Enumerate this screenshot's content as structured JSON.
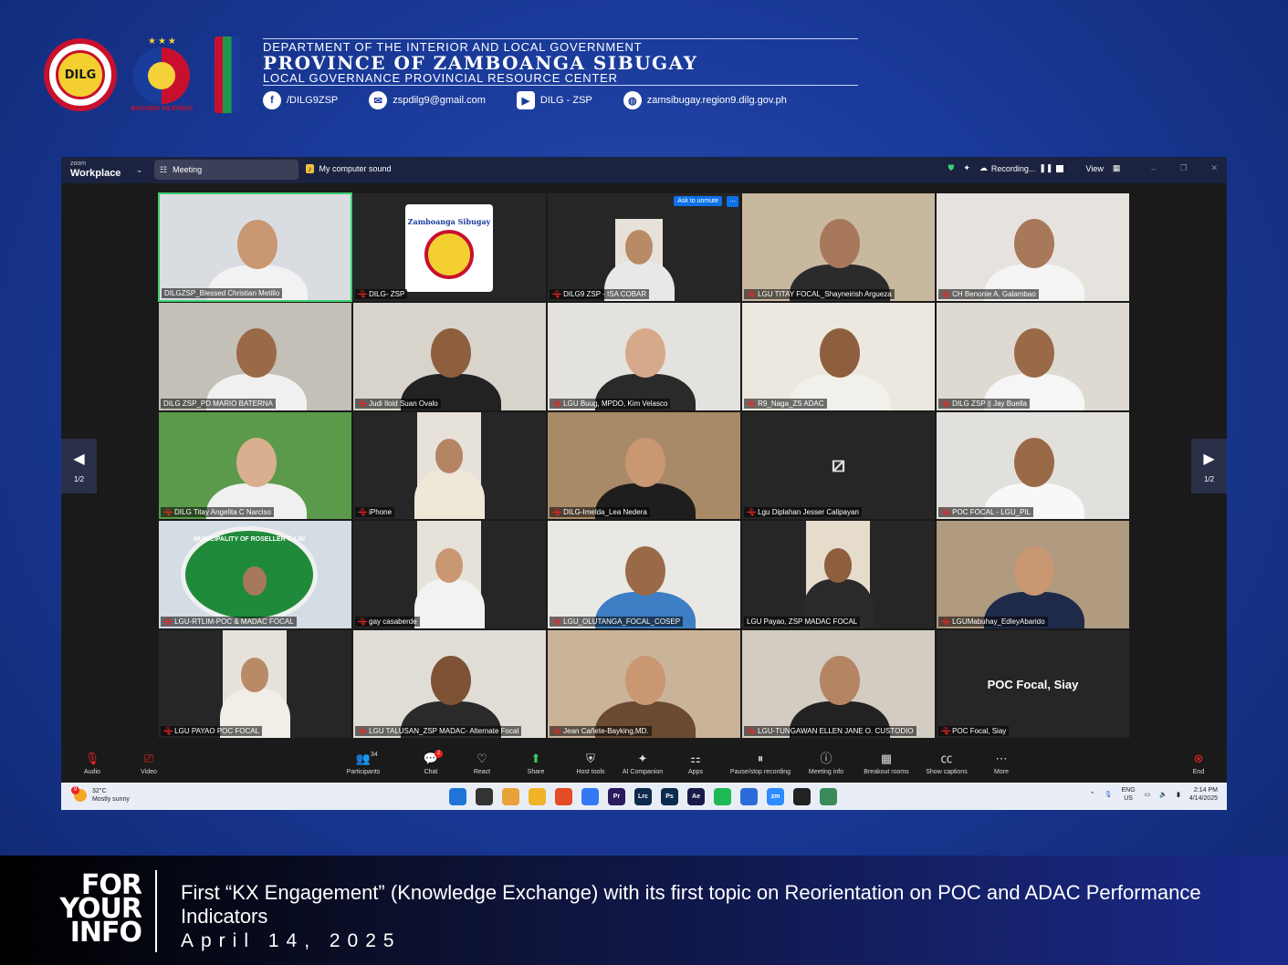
{
  "header": {
    "seal_text": "DILG",
    "bp_text": "BAGONG PILIPINAS",
    "dept": "DEPARTMENT OF THE INTERIOR AND LOCAL GOVERNMENT",
    "province": "PROVINCE OF ZAMBOANGA SIBUGAY",
    "center": "LOCAL GOVERNANCE PROVINCIAL RESOURCE CENTER",
    "contacts": [
      {
        "icon": "facebook-icon",
        "text": "/DILG9ZSP"
      },
      {
        "icon": "email-icon",
        "text": "zspdilg9@gmail.com"
      },
      {
        "icon": "youtube-icon",
        "text": "DILG - ZSP"
      },
      {
        "icon": "globe-icon",
        "text": "zamsibugay.region9.dilg.gov.ph"
      }
    ]
  },
  "zoom": {
    "brand_top": "zoom",
    "brand": "Workplace",
    "meeting_tab": "Meeting",
    "sound": "My computer sound",
    "recording": "Recording...",
    "view": "View",
    "ask_unmute": "Ask to unmute",
    "page_left": "1/2",
    "page_right": "1/2",
    "participants": [
      {
        "name": "DILGZSP_Blessed Christian Metillo",
        "muted": false,
        "bg": "#d9dde2",
        "skin": "#c99772",
        "shirt": "#f2f2f2",
        "active": true
      },
      {
        "name": "DILG- ZSP",
        "muted": true,
        "bg": "#262626",
        "logo": "Zamboanga Sibugay"
      },
      {
        "name": "DILG9 ZSP - ISA COBAR",
        "muted": true,
        "bg": "#262626",
        "small": true,
        "skin": "#b98a66",
        "shirt": "#e8e8e8"
      },
      {
        "name": "LGU TITAY FOCAL_Shayneirish Argueza",
        "muted": true,
        "bg": "#c8b8a0",
        "skin": "#a8785a",
        "shirt": "#2b2b2b"
      },
      {
        "name": "CH Benonie A. Galambao",
        "muted": true,
        "bg": "#e6e3de",
        "skin": "#a8785a",
        "shirt": "#f4f4f4"
      },
      {
        "name": "DILG ZSP_PD MARIO BATERNA",
        "muted": false,
        "bg": "#c4c0b8",
        "skin": "#9a6a48",
        "shirt": "#f0f0f0"
      },
      {
        "name": "Judi Iloid Suan Ovalo",
        "muted": true,
        "bg": "#d8d4cc",
        "skin": "#8e5f3e",
        "shirt": "#222"
      },
      {
        "name": "LGU Buug, MPDO, Kim Velasco",
        "muted": true,
        "bg": "#e4e2de",
        "skin": "#d6a98a",
        "shirt": "#2a2a2a"
      },
      {
        "name": "R9_Naga_ZS ADAC",
        "muted": true,
        "bg": "#ece8e0",
        "skin": "#8e5f3e",
        "shirt": "#f2f0ea"
      },
      {
        "name": "DILG ZSP || Jay Buella",
        "muted": true,
        "bg": "#dedad2",
        "skin": "#9a6a48",
        "shirt": "#f6f6f6"
      },
      {
        "name": "DILG Titay Angelita C Narciso",
        "muted": true,
        "bg": "#5a9a4a",
        "skin": "#d8b090",
        "shirt": "#f0f0f0"
      },
      {
        "name": "iPhone",
        "muted": true,
        "bg": "#262626",
        "small": true,
        "skin": "#b58563",
        "shirt": "#efe8d8"
      },
      {
        "name": "DILG-Imelda_Lea Nedera",
        "muted": true,
        "bg": "#a88a68",
        "skin": "#c99772",
        "shirt": "#1e1e1e"
      },
      {
        "name": "Lgu Diplahan Jesser Calipayan",
        "muted": true,
        "bg": "#262626",
        "cam_off": true
      },
      {
        "name": "POC FOCAL - LGU_PIL",
        "muted": true,
        "bg": "#e2e0dc",
        "skin": "#9a6a48",
        "shirt": "#f8f8f8"
      },
      {
        "name": "LGU-RTLIM-POC & MADAC FOCAL",
        "muted": true,
        "bg": "#d4dce4",
        "logo": "MUNICIPALITY OF ROSELLER T. LIM"
      },
      {
        "name": "gay casaberde",
        "muted": true,
        "bg": "#262626",
        "small": true,
        "skin": "#c99772",
        "shirt": "#f2f2f2"
      },
      {
        "name": "LGU_OLUTANGA_FOCAL_COSEP",
        "muted": true,
        "bg": "#eae8e4",
        "skin": "#9a6a48",
        "shirt": "#3d7ec4"
      },
      {
        "name": "LGU Payao, ZSP MADAC FOCAL",
        "muted": false,
        "bg": "#e6dccc",
        "small": true,
        "skin": "#8e5f3e",
        "shirt": "#2a2a2a"
      },
      {
        "name": "LGUMabuhay_EdleyAbarido",
        "muted": true,
        "bg": "#b09a80",
        "skin": "#c99772",
        "shirt": "#1f2a4a"
      },
      {
        "name": "LGU PAYAO POC FOCAL",
        "muted": true,
        "bg": "#262626",
        "small": true,
        "skin": "#b98a66",
        "shirt": "#f0eee6"
      },
      {
        "name": "LGU TALUSAN_ZSP MADAC- Alternate Focal",
        "muted": true,
        "bg": "#e0ddd6",
        "skin": "#7e5234",
        "shirt": "#2a2a2a"
      },
      {
        "name": "Jean Cañete-Bayking,MD.",
        "muted": true,
        "bg": "#c9b49a",
        "skin": "#c99772",
        "shirt": "#6a4a30"
      },
      {
        "name": "LGU-TUNGAWAN ELLEN JANE O. CUSTODIO",
        "muted": true,
        "bg": "#d2ccc2",
        "skin": "#b58563",
        "shirt": "#222"
      },
      {
        "name": "POC Focal, Siay",
        "muted": true,
        "bg": "#262626",
        "text_only": true
      }
    ],
    "toolbar": [
      {
        "icon": "mic-muted-icon",
        "label": "Audio"
      },
      {
        "icon": "video-off-icon",
        "label": "Video"
      },
      {
        "icon": "participants-icon",
        "label": "Participants",
        "count": "34"
      },
      {
        "icon": "chat-icon",
        "label": "Chat",
        "badge": "2"
      },
      {
        "icon": "react-icon",
        "label": "React"
      },
      {
        "icon": "share-icon",
        "label": "Share"
      },
      {
        "icon": "host-tools-icon",
        "label": "Host tools"
      },
      {
        "icon": "ai-companion-icon",
        "label": "AI Companion"
      },
      {
        "icon": "apps-icon",
        "label": "Apps"
      },
      {
        "icon": "pause-stop-recording-icon",
        "label": "Pause/stop recording"
      },
      {
        "icon": "meeting-info-icon",
        "label": "Meeting info"
      },
      {
        "icon": "breakout-rooms-icon",
        "label": "Breakout rooms"
      },
      {
        "icon": "captions-icon",
        "label": "Show captions"
      },
      {
        "icon": "more-icon",
        "label": "More"
      },
      {
        "icon": "end-icon",
        "label": "End"
      }
    ]
  },
  "taskbar": {
    "weather_badge": "9",
    "temp": "32°C",
    "condition": "Mostly sunny",
    "lang": "ENG",
    "region": "US",
    "time": "2:14 PM",
    "date": "4/14/2025",
    "apps": [
      {
        "label": "",
        "color": "#1e74d8"
      },
      {
        "label": "",
        "color": "#333"
      },
      {
        "label": "",
        "color": "#e8a23a"
      },
      {
        "label": "",
        "color": "#f0b429"
      },
      {
        "label": "",
        "color": "#e34c26"
      },
      {
        "label": "",
        "color": "#3478f6"
      },
      {
        "label": "Pr",
        "color": "#2a1a5e"
      },
      {
        "label": "Lrc",
        "color": "#0c2a4a"
      },
      {
        "label": "Ps",
        "color": "#0a2a4e"
      },
      {
        "label": "Ae",
        "color": "#1a1a4a"
      },
      {
        "label": "",
        "color": "#1db954"
      },
      {
        "label": "",
        "color": "#2a6bd8"
      },
      {
        "label": "zm",
        "color": "#2d8cff"
      },
      {
        "label": "",
        "color": "#222"
      },
      {
        "label": "",
        "color": "#3a8a5a"
      }
    ]
  },
  "banner": {
    "fyi": [
      "FOR",
      "YOUR",
      "INFO"
    ],
    "caption": "First “KX Engagement” (Knowledge Exchange) with its first topic on Reorientation on POC and ADAC Performance Indicators",
    "date": "April 14, 2025"
  }
}
